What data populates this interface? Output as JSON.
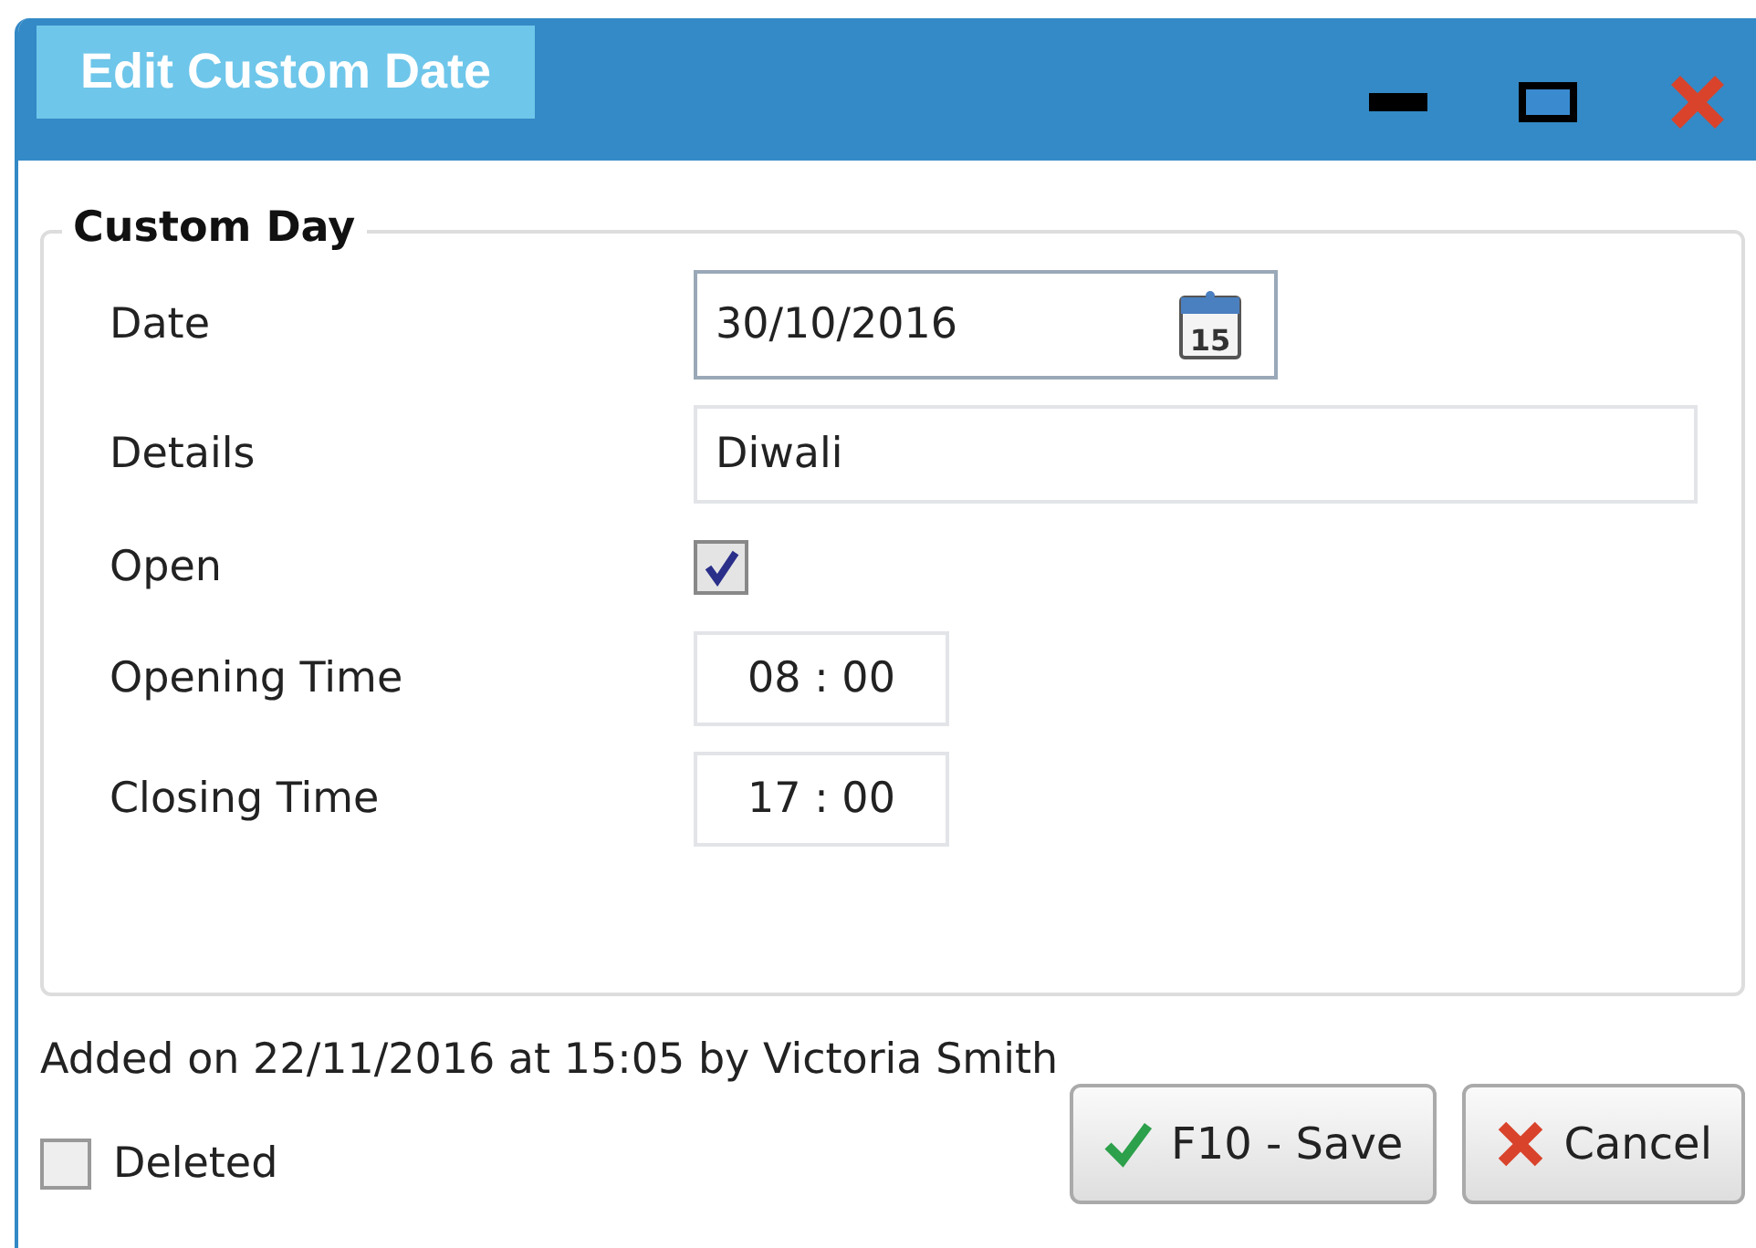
{
  "window": {
    "title": "Edit Custom Date"
  },
  "group": {
    "title": "Custom Day",
    "rows": [
      {
        "kind": "date",
        "label": "Date",
        "value": "30/10/2016",
        "calendar_day": "15"
      },
      {
        "kind": "text",
        "label": "Details",
        "value": "Diwali"
      },
      {
        "kind": "checkbox",
        "label": "Open",
        "checked": true
      },
      {
        "kind": "time",
        "label": "Opening Time",
        "value": "08 : 00"
      },
      {
        "kind": "time",
        "label": "Closing Time",
        "value": "17 : 00"
      }
    ]
  },
  "audit": "Added on 22/11/2016 at 15:05 by Victoria Smith",
  "deleted": {
    "label": "Deleted",
    "checked": false
  },
  "buttons": [
    {
      "kind": "save",
      "label": "F10 - Save"
    },
    {
      "kind": "cancel",
      "label": "Cancel"
    }
  ]
}
